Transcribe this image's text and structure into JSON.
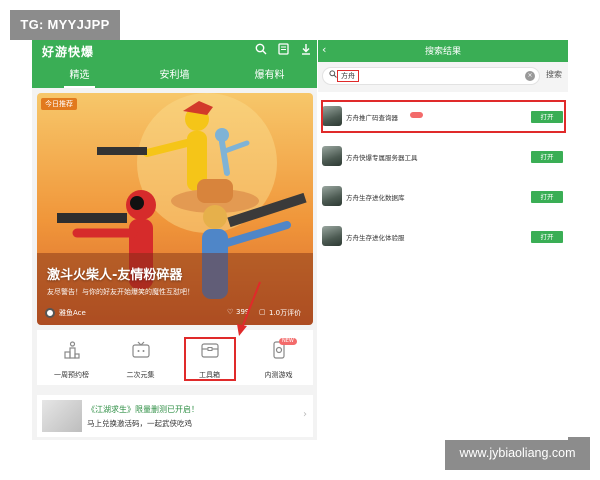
{
  "watermark": {
    "tg": "TG: MYYJJPP",
    "site": "www.jybiaoliang.com"
  },
  "left": {
    "app_title": "好游快爆",
    "icons": {
      "search": "search-icon",
      "message": "message-icon",
      "download": "download-icon"
    },
    "tabs": [
      {
        "label": "精选",
        "active": true
      },
      {
        "label": "安利墙",
        "active": false
      },
      {
        "label": "爆有料",
        "active": false
      }
    ],
    "banner": {
      "tag": "今日推荐",
      "title": "激斗火柴人-友情粉碎器",
      "subtitle": "友尽警告！与你的好友开始爆笑的魔性互怼吧！",
      "author": "雅鱼Ace",
      "likes": "399",
      "comments": "1.0万评价"
    },
    "shortcuts": [
      {
        "label": "一周预约榜",
        "icon": "trophy-icon"
      },
      {
        "label": "二次元集",
        "icon": "tv-icon"
      },
      {
        "label": "工具箱",
        "icon": "toolbox-icon"
      },
      {
        "label": "内测游戏",
        "icon": "phone-game-icon"
      }
    ],
    "promo": {
      "title": "《江湖求生》限量删测已开启！",
      "subtitle": "马上兑换激活码，一起武侠吃鸡"
    }
  },
  "right": {
    "title": "搜索结果",
    "search": {
      "query": "方舟",
      "button": "搜索"
    },
    "results": [
      {
        "name": "方舟推广码查询器",
        "button": "打开"
      },
      {
        "name": "方舟快爆专属服务器工具",
        "button": "打开"
      },
      {
        "name": "方舟生存进化数据库",
        "button": "打开"
      },
      {
        "name": "方舟生存进化体验服",
        "button": "打开"
      }
    ]
  },
  "colors": {
    "brand_green": "#3aae55",
    "highlight_red": "#e02a2a"
  }
}
